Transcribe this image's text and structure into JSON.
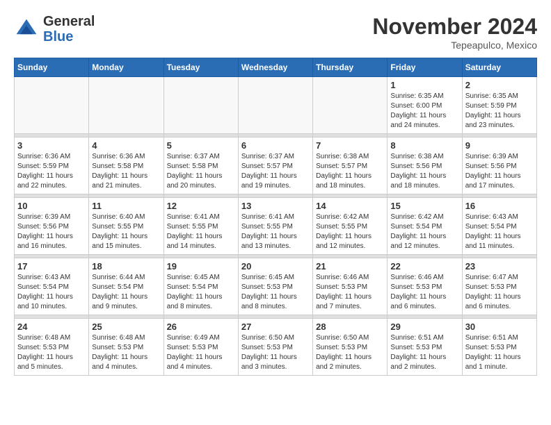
{
  "header": {
    "logo_general": "General",
    "logo_blue": "Blue",
    "month_title": "November 2024",
    "location": "Tepeapulco, Mexico"
  },
  "weekdays": [
    "Sunday",
    "Monday",
    "Tuesday",
    "Wednesday",
    "Thursday",
    "Friday",
    "Saturday"
  ],
  "weeks": [
    [
      {
        "day": "",
        "empty": true
      },
      {
        "day": "",
        "empty": true
      },
      {
        "day": "",
        "empty": true
      },
      {
        "day": "",
        "empty": true
      },
      {
        "day": "",
        "empty": true
      },
      {
        "day": "1",
        "sunrise": "Sunrise: 6:35 AM",
        "sunset": "Sunset: 6:00 PM",
        "daylight": "Daylight: 11 hours and 24 minutes."
      },
      {
        "day": "2",
        "sunrise": "Sunrise: 6:35 AM",
        "sunset": "Sunset: 5:59 PM",
        "daylight": "Daylight: 11 hours and 23 minutes."
      }
    ],
    [
      {
        "day": "3",
        "sunrise": "Sunrise: 6:36 AM",
        "sunset": "Sunset: 5:59 PM",
        "daylight": "Daylight: 11 hours and 22 minutes."
      },
      {
        "day": "4",
        "sunrise": "Sunrise: 6:36 AM",
        "sunset": "Sunset: 5:58 PM",
        "daylight": "Daylight: 11 hours and 21 minutes."
      },
      {
        "day": "5",
        "sunrise": "Sunrise: 6:37 AM",
        "sunset": "Sunset: 5:58 PM",
        "daylight": "Daylight: 11 hours and 20 minutes."
      },
      {
        "day": "6",
        "sunrise": "Sunrise: 6:37 AM",
        "sunset": "Sunset: 5:57 PM",
        "daylight": "Daylight: 11 hours and 19 minutes."
      },
      {
        "day": "7",
        "sunrise": "Sunrise: 6:38 AM",
        "sunset": "Sunset: 5:57 PM",
        "daylight": "Daylight: 11 hours and 18 minutes."
      },
      {
        "day": "8",
        "sunrise": "Sunrise: 6:38 AM",
        "sunset": "Sunset: 5:56 PM",
        "daylight": "Daylight: 11 hours and 18 minutes."
      },
      {
        "day": "9",
        "sunrise": "Sunrise: 6:39 AM",
        "sunset": "Sunset: 5:56 PM",
        "daylight": "Daylight: 11 hours and 17 minutes."
      }
    ],
    [
      {
        "day": "10",
        "sunrise": "Sunrise: 6:39 AM",
        "sunset": "Sunset: 5:56 PM",
        "daylight": "Daylight: 11 hours and 16 minutes."
      },
      {
        "day": "11",
        "sunrise": "Sunrise: 6:40 AM",
        "sunset": "Sunset: 5:55 PM",
        "daylight": "Daylight: 11 hours and 15 minutes."
      },
      {
        "day": "12",
        "sunrise": "Sunrise: 6:41 AM",
        "sunset": "Sunset: 5:55 PM",
        "daylight": "Daylight: 11 hours and 14 minutes."
      },
      {
        "day": "13",
        "sunrise": "Sunrise: 6:41 AM",
        "sunset": "Sunset: 5:55 PM",
        "daylight": "Daylight: 11 hours and 13 minutes."
      },
      {
        "day": "14",
        "sunrise": "Sunrise: 6:42 AM",
        "sunset": "Sunset: 5:55 PM",
        "daylight": "Daylight: 11 hours and 12 minutes."
      },
      {
        "day": "15",
        "sunrise": "Sunrise: 6:42 AM",
        "sunset": "Sunset: 5:54 PM",
        "daylight": "Daylight: 11 hours and 12 minutes."
      },
      {
        "day": "16",
        "sunrise": "Sunrise: 6:43 AM",
        "sunset": "Sunset: 5:54 PM",
        "daylight": "Daylight: 11 hours and 11 minutes."
      }
    ],
    [
      {
        "day": "17",
        "sunrise": "Sunrise: 6:43 AM",
        "sunset": "Sunset: 5:54 PM",
        "daylight": "Daylight: 11 hours and 10 minutes."
      },
      {
        "day": "18",
        "sunrise": "Sunrise: 6:44 AM",
        "sunset": "Sunset: 5:54 PM",
        "daylight": "Daylight: 11 hours and 9 minutes."
      },
      {
        "day": "19",
        "sunrise": "Sunrise: 6:45 AM",
        "sunset": "Sunset: 5:54 PM",
        "daylight": "Daylight: 11 hours and 8 minutes."
      },
      {
        "day": "20",
        "sunrise": "Sunrise: 6:45 AM",
        "sunset": "Sunset: 5:53 PM",
        "daylight": "Daylight: 11 hours and 8 minutes."
      },
      {
        "day": "21",
        "sunrise": "Sunrise: 6:46 AM",
        "sunset": "Sunset: 5:53 PM",
        "daylight": "Daylight: 11 hours and 7 minutes."
      },
      {
        "day": "22",
        "sunrise": "Sunrise: 6:46 AM",
        "sunset": "Sunset: 5:53 PM",
        "daylight": "Daylight: 11 hours and 6 minutes."
      },
      {
        "day": "23",
        "sunrise": "Sunrise: 6:47 AM",
        "sunset": "Sunset: 5:53 PM",
        "daylight": "Daylight: 11 hours and 6 minutes."
      }
    ],
    [
      {
        "day": "24",
        "sunrise": "Sunrise: 6:48 AM",
        "sunset": "Sunset: 5:53 PM",
        "daylight": "Daylight: 11 hours and 5 minutes."
      },
      {
        "day": "25",
        "sunrise": "Sunrise: 6:48 AM",
        "sunset": "Sunset: 5:53 PM",
        "daylight": "Daylight: 11 hours and 4 minutes."
      },
      {
        "day": "26",
        "sunrise": "Sunrise: 6:49 AM",
        "sunset": "Sunset: 5:53 PM",
        "daylight": "Daylight: 11 hours and 4 minutes."
      },
      {
        "day": "27",
        "sunrise": "Sunrise: 6:50 AM",
        "sunset": "Sunset: 5:53 PM",
        "daylight": "Daylight: 11 hours and 3 minutes."
      },
      {
        "day": "28",
        "sunrise": "Sunrise: 6:50 AM",
        "sunset": "Sunset: 5:53 PM",
        "daylight": "Daylight: 11 hours and 2 minutes."
      },
      {
        "day": "29",
        "sunrise": "Sunrise: 6:51 AM",
        "sunset": "Sunset: 5:53 PM",
        "daylight": "Daylight: 11 hours and 2 minutes."
      },
      {
        "day": "30",
        "sunrise": "Sunrise: 6:51 AM",
        "sunset": "Sunset: 5:53 PM",
        "daylight": "Daylight: 11 hours and 1 minute."
      }
    ]
  ]
}
